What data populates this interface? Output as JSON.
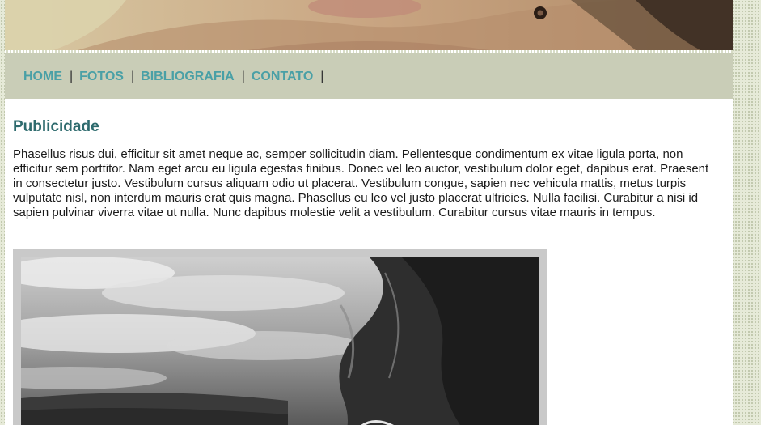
{
  "nav": {
    "items": [
      {
        "label": "HOME"
      },
      {
        "label": "FOTOS"
      },
      {
        "label": "BIBLIOGRAFIA"
      },
      {
        "label": "CONTATO"
      }
    ],
    "separator": "|"
  },
  "main": {
    "heading": "Publicidade",
    "paragraph": "Phasellus risus dui, efficitur sit amet neque ac, semper sollicitudin diam. Pellentesque condimentum ex vitae ligula porta, non efficitur sem porttitor. Nam eget arcu eu ligula egestas finibus. Donec vel leo auctor, vestibulum dolor eget, dapibus erat. Praesent in consectetur justo. Vestibulum cursus aliquam odio ut placerat. Vestibulum congue, sapien nec vehicula mattis, metus turpis vulputate nisl, non interdum mauris erat quis magna. Phasellus eu leo vel justo placerat ultricies. Nulla facilisi. Curabitur a nisi id sapien pulvinar viverra vitae ut nulla. Nunc dapibus molestie velit a vestibulum. Curabitur cursus vitae mauris in tempus."
  },
  "colors": {
    "nav_link": "#4aa0a6",
    "heading": "#2e6b6e",
    "nav_background": "#c9cdb7"
  }
}
